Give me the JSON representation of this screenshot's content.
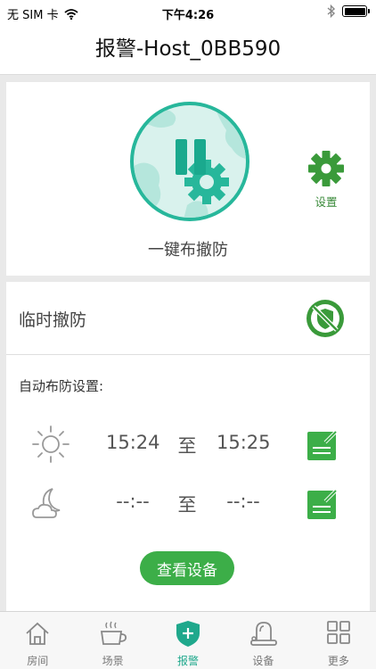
{
  "status_bar": {
    "carrier": "无 SIM 卡",
    "time": "下午4:26"
  },
  "nav": {
    "title": "报警-Host_0BB590"
  },
  "arm": {
    "label": "一键布撤防",
    "state_icon": "pause-icon"
  },
  "settings": {
    "label": "设置",
    "icon": "gear-icon"
  },
  "temporary": {
    "label": "临时撤防",
    "icon": "disarm-shield-icon"
  },
  "auto": {
    "title": "自动布防设置:",
    "schedules": [
      {
        "icon": "sun-icon",
        "from": "15:24",
        "to": "至",
        "until": "15:25"
      },
      {
        "icon": "moon-icon",
        "from": "--:--",
        "to": "至",
        "until": "--:--"
      }
    ]
  },
  "view_devices": {
    "label": "查看设备"
  },
  "tabs": [
    {
      "label": "房间",
      "icon": "home-icon"
    },
    {
      "label": "场景",
      "icon": "cup-icon"
    },
    {
      "label": "报警",
      "icon": "alarm-shield-icon",
      "active": true
    },
    {
      "label": "设备",
      "icon": "device-icon"
    },
    {
      "label": "更多",
      "icon": "grid-icon"
    }
  ],
  "colors": {
    "accent_teal": "#27b79b",
    "accent_green": "#3cae48",
    "tab_active": "#1fa88c"
  }
}
